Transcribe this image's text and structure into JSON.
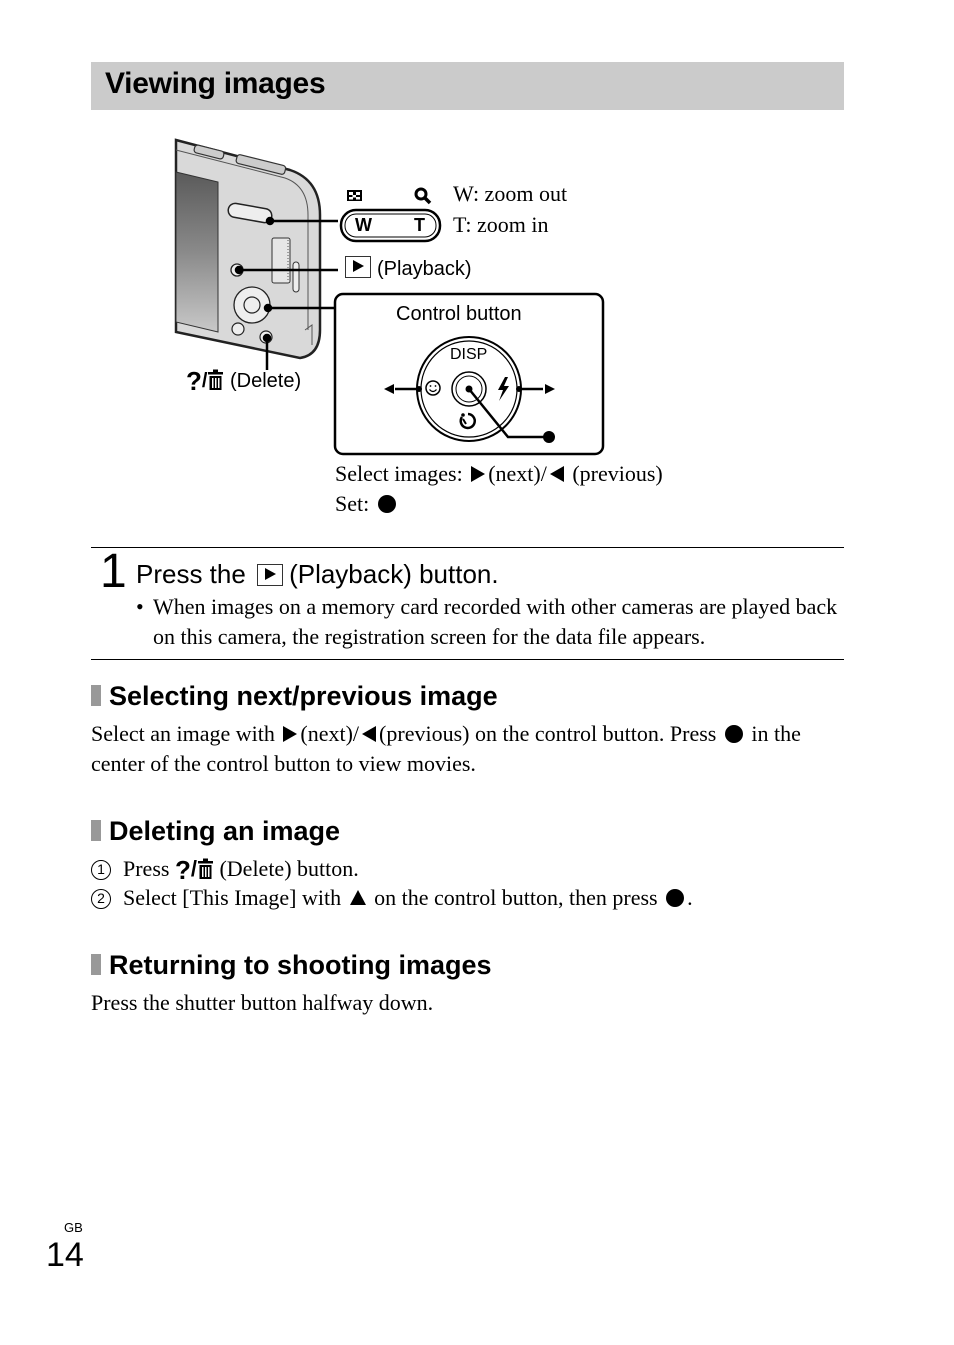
{
  "page": {
    "title": "Viewing images",
    "region_code": "GB",
    "page_number": "14"
  },
  "diagram": {
    "zoom_lever": {
      "w_label": "W",
      "t_label": "T",
      "index_icon": "index-grid-icon",
      "magnify_icon": "magnifier-icon",
      "w_desc": "W: zoom out",
      "t_desc": "T: zoom in"
    },
    "playback_label": "(Playback)",
    "delete_label": "(Delete)",
    "help_symbol": "?",
    "control_button": {
      "title": "Control button",
      "top_label": "DISP",
      "left_icon": "smile-face-icon",
      "right_icon": "flash-icon",
      "bottom_icon": "self-timer-icon"
    },
    "caption_select_prefix": "Select images:",
    "caption_next": "(next)/",
    "caption_previous": "(previous)",
    "caption_set": "Set:"
  },
  "step1": {
    "number": "1",
    "title_prefix": "Press the",
    "title_suffix": "(Playback) button.",
    "bullet": "•",
    "note": "When images on a memory card recorded with other cameras are played back on this camera, the registration screen for the data file appears."
  },
  "sections": [
    {
      "heading": "Selecting next/previous image",
      "text_a": "Select an image with",
      "text_b": "(next)/",
      "text_c": "(previous) on the control button. Press",
      "text_d": "in the center of the control button to view movies."
    },
    {
      "heading": "Deleting an image",
      "items": [
        {
          "num": "1",
          "prefix": "Press",
          "suffix": "(Delete) button."
        },
        {
          "num": "2",
          "prefix": "Select [This Image] with",
          "middle": "on the control button, then press",
          "suffix": "."
        }
      ]
    },
    {
      "heading": "Returning to shooting images",
      "text": "Press the shutter button halfway down."
    }
  ]
}
